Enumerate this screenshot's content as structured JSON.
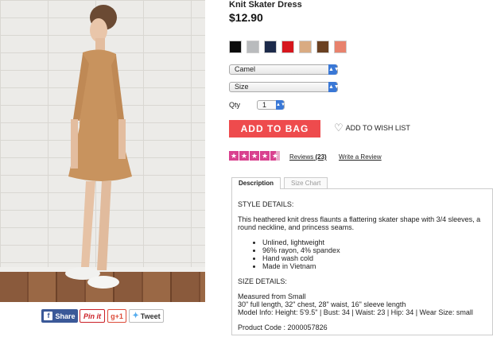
{
  "product": {
    "title": "Knit Skater Dress",
    "price": "$12.90",
    "swatch_colors": [
      "#0b0b0b",
      "#b9bbbd",
      "#1c2a4a",
      "#d6161d",
      "#d9ab82",
      "#6a4021",
      "#e8826d"
    ],
    "color_select": "Camel",
    "size_select": "Size",
    "qty_label": "Qty",
    "qty_value": "1",
    "add_to_bag": "ADD TO BAG",
    "wish_list": "ADD TO WISH LIST",
    "rating": 4.6,
    "reviews_label": "Reviews",
    "reviews_count": "(23)",
    "write_review": "Write a Review"
  },
  "share": {
    "facebook": "Share",
    "pinterest": "Pin it",
    "googleplus": "g+1",
    "twitter": "Tweet"
  },
  "tabs": {
    "description": "Description",
    "size_chart": "Size Chart"
  },
  "description": {
    "style_heading": "STYLE DETAILS:",
    "style_text": "This heathered knit dress flaunts a flattering skater shape with 3/4 sleeves, a round neckline, and princess seams.",
    "bullets": [
      "Unlined, lightweight",
      "96% rayon, 4% spandex",
      "Hand wash cold",
      "Made in Vietnam"
    ],
    "size_heading": "SIZE DETAILS:",
    "measured": "Measured from Small",
    "lengths": "30\" full length, 32\" chest, 28\" waist, 16\" sleeve length",
    "model_info": "Model Info: Height: 5'9.5\" | Bust: 34 | Waist: 23 | Hip: 34 | Wear Size: small",
    "product_code": "Product Code : 2000057826"
  }
}
